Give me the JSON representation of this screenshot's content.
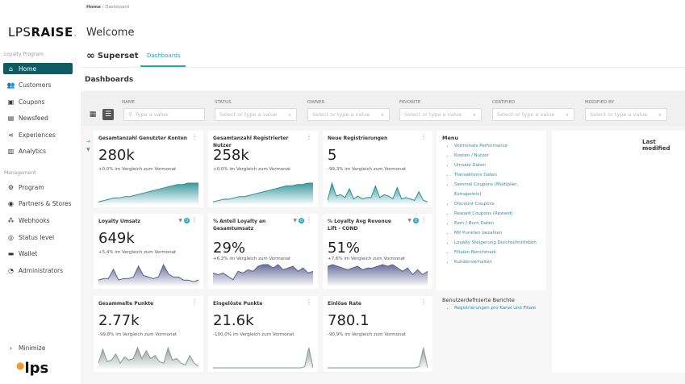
{
  "sidebar": {
    "logo": {
      "light": "LPS",
      "bold": "RAISE",
      "dot": "."
    },
    "section1": "Loyalty Program",
    "items1": [
      {
        "label": "Home",
        "icon": "home-icon",
        "glyph": "⌂",
        "active": true
      },
      {
        "label": "Customers",
        "icon": "customers-icon",
        "glyph": "👥"
      },
      {
        "label": "Coupons",
        "icon": "coupons-icon",
        "glyph": "▣"
      },
      {
        "label": "Newsfeed",
        "icon": "newsfeed-icon",
        "glyph": "▤"
      },
      {
        "label": "Experiences",
        "icon": "share-icon",
        "glyph": "⋖"
      },
      {
        "label": "Analytics",
        "icon": "analytics-icon",
        "glyph": "▥"
      }
    ],
    "section2": "Management",
    "items2": [
      {
        "label": "Program",
        "icon": "gear-icon",
        "glyph": "⚙"
      },
      {
        "label": "Partners & Stores",
        "icon": "partners-icon",
        "glyph": "◉"
      },
      {
        "label": "Webhooks",
        "icon": "webhooks-icon",
        "glyph": "⁂"
      },
      {
        "label": "Status level",
        "icon": "status-icon",
        "glyph": "◎"
      },
      {
        "label": "Wallet",
        "icon": "wallet-icon",
        "glyph": "▬"
      },
      {
        "label": "Administrators",
        "icon": "admin-icon",
        "glyph": "◔"
      }
    ],
    "minimize": "Minimize",
    "footer_logo": "lps"
  },
  "header": {
    "breadcrumb_home": "Home",
    "breadcrumb_sep": " / ",
    "breadcrumb_current": "Dashboard",
    "title": "Welcome"
  },
  "superset": {
    "logo": "Superset",
    "tab": "Dashboards",
    "page_title": "Dashboards"
  },
  "filters": [
    {
      "label": "NAME",
      "placeholder": "Type a value",
      "type": "search"
    },
    {
      "label": "STATUS",
      "placeholder": "Select or type a value",
      "type": "select"
    },
    {
      "label": "OWNER",
      "placeholder": "Select or type a value",
      "type": "select"
    },
    {
      "label": "FAVORITE",
      "placeholder": "Select or type a value",
      "type": "select"
    },
    {
      "label": "CERTIFIED",
      "placeholder": "Select or type a value",
      "type": "select"
    },
    {
      "label": "MODIFIED BY",
      "placeholder": "Select or type a value",
      "type": "select"
    }
  ],
  "cards": [
    {
      "title": "Gesamtanzahl Genutzter Konten",
      "value": "280k",
      "sub": "+0,0% im Vergleich zum Vormonat",
      "color": "#2a8f94",
      "filter": false,
      "spark": [
        1,
        2,
        3,
        4,
        4,
        5,
        5,
        6,
        7,
        8,
        9,
        10,
        11,
        12,
        13,
        14,
        14,
        15,
        15,
        15
      ]
    },
    {
      "title": "Gesamtanzahl Registrierter Nutzer",
      "value": "258k",
      "sub": "+0,0% im Vergleich zum Vormonat",
      "color": "#2a8f94",
      "filter": false,
      "spark": [
        1,
        2,
        3,
        3,
        4,
        5,
        5,
        6,
        7,
        8,
        9,
        10,
        11,
        12,
        13,
        13,
        14,
        14,
        15,
        15
      ]
    },
    {
      "title": "Neue Registrierungen",
      "value": "5",
      "sub": "-99,3% im Vergleich zum Vormonat",
      "color": "#2a8f94",
      "filter": false,
      "spark": [
        2,
        14,
        5,
        6,
        4,
        10,
        3,
        5,
        3,
        4,
        4,
        12,
        4,
        6,
        5,
        3,
        11,
        3,
        4,
        3,
        2,
        8,
        2,
        1
      ]
    },
    {
      "title": "Loyalty Umsatz",
      "value": "649k",
      "sub": "+5,4% im Vergleich zum Vormonat",
      "color": "#5a5f8f",
      "filter": true,
      "filter_count": "0",
      "spark": [
        3,
        4,
        4,
        10,
        3,
        4,
        4,
        5,
        12,
        6,
        5,
        4,
        5,
        13,
        7,
        5,
        5,
        3,
        3,
        2,
        3
      ]
    },
    {
      "title": "% Anteil Loyalty an Gesamtumsatz",
      "value": "29%",
      "sub": "+6,2% im Vergleich zum Vormonat",
      "color": "#5a5f8f",
      "filter": true,
      "filter_count": "0",
      "spark": [
        7,
        6,
        7,
        5,
        3,
        8,
        7,
        9,
        8,
        11,
        12,
        12,
        10,
        12,
        9,
        10,
        11,
        8,
        10,
        7,
        8
      ]
    },
    {
      "title": "% Loyalty Avg Revenue Lift - COND",
      "value": "51%",
      "sub": "+7,6% im Vergleich zum Vormonat",
      "color": "#5a5f8f",
      "filter": true,
      "filter_count": "0",
      "spark": [
        11,
        12,
        11,
        10,
        9,
        10,
        11,
        9,
        10,
        10,
        11,
        12,
        11,
        12,
        10,
        8,
        10,
        6,
        9,
        6,
        8
      ]
    },
    {
      "title": "Gesammelte Punkte",
      "value": "2.77k",
      "sub": "-99,8% im Vergleich zum Vormonat",
      "color": "#8a9696",
      "filter": false,
      "spark": [
        3,
        12,
        4,
        5,
        9,
        3,
        7,
        5,
        6,
        13,
        6,
        11,
        6,
        8,
        4,
        3,
        13,
        5,
        6,
        3,
        2,
        8,
        3,
        1
      ]
    },
    {
      "title": "Eingelöste Punkte",
      "value": "21.6k",
      "sub": "-100,0% im Vergleich zum Vormonat",
      "color": "#8a9696",
      "filter": false,
      "spark": [
        0,
        0,
        0,
        0,
        0,
        0,
        0,
        0,
        0,
        0,
        0,
        0,
        0,
        0,
        0,
        0,
        0,
        0,
        0,
        0,
        0,
        0,
        1,
        18,
        0
      ]
    },
    {
      "title": "Einlöse Rate",
      "value": "780.1",
      "sub": "-90,9% im Vergleich zum Vormonat",
      "color": "#8a9696",
      "filter": false,
      "spark": [
        0,
        0,
        0,
        0,
        0,
        0,
        0,
        0,
        0,
        0,
        0,
        0,
        0,
        0,
        0,
        0,
        0,
        0,
        0,
        0,
        0,
        0,
        1,
        16,
        0
      ]
    }
  ],
  "menu": {
    "title": "Menu",
    "links": [
      "Vormonats Performance",
      "Konten / Nutzer",
      "Umsatz Daten",
      "Transaktions Daten",
      "Sammel Coupons (Multiplier, Extrapoints)",
      "Discount Coupons",
      "Reward Coupons (Reward)",
      "Earn / Burn Daten",
      "Mit Punkten bezahlen",
      "Loyalty Steigerung Durchschnittsbon",
      "Filialen Benchmark",
      "Kundenverhalten"
    ],
    "custom_title": "Benutzerdefinierte Berichte",
    "custom_links": [
      "Registrierungen pro Kanal und Filiale"
    ]
  },
  "last_modified": "Last modified",
  "sort_glyph": "▾",
  "colors": {
    "brand": "#0d5c63",
    "accent": "#20a7c9",
    "logo_dot": "#f39c2b"
  }
}
